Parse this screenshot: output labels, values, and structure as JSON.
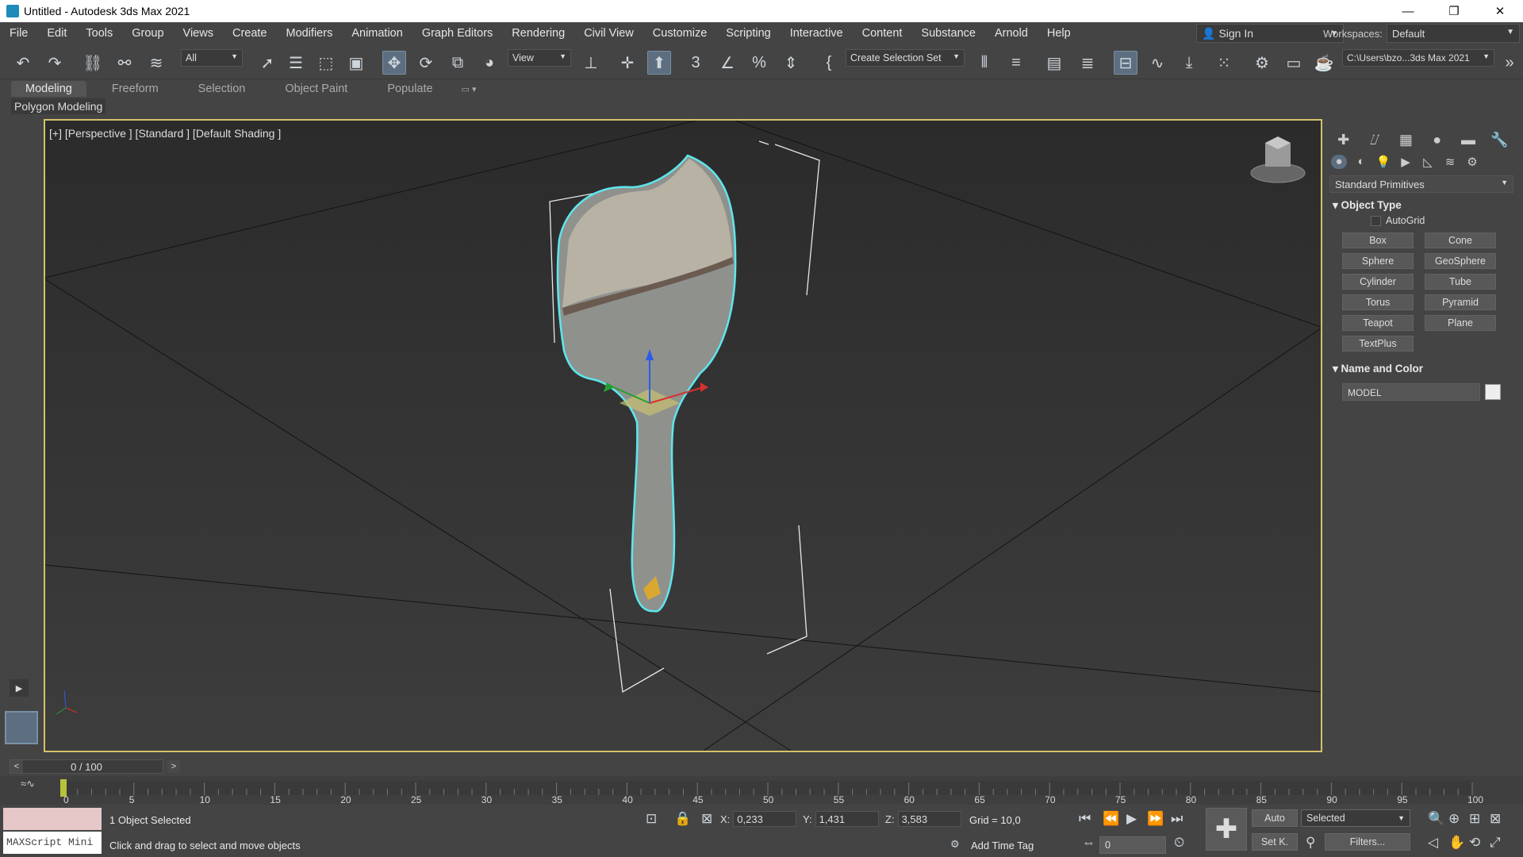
{
  "window": {
    "title": "Untitled - Autodesk 3ds Max 2021",
    "minimize": "—",
    "maximize": "❐",
    "close": "✕"
  },
  "menu": [
    "File",
    "Edit",
    "Tools",
    "Group",
    "Views",
    "Create",
    "Modifiers",
    "Animation",
    "Graph Editors",
    "Rendering",
    "Civil View",
    "Customize",
    "Scripting",
    "Interactive",
    "Content",
    "Substance",
    "Arnold",
    "Help"
  ],
  "signin": {
    "label": "Sign In"
  },
  "workspaces": {
    "label": "Workspaces:",
    "value": "Default"
  },
  "toolbar": {
    "filter": "All",
    "refcoord": "View",
    "selection_set": "Create Selection Set",
    "project_path": "C:\\Users\\bzo...3ds Max 2021"
  },
  "ribbon": {
    "tabs": [
      "Modeling",
      "Freeform",
      "Selection",
      "Object Paint",
      "Populate"
    ],
    "active": "Modeling",
    "panel": "Polygon Modeling"
  },
  "viewport": {
    "label": "[+] [Perspective ] [Standard ] [Default Shading ]"
  },
  "command_panel": {
    "category": "Standard Primitives",
    "object_type": {
      "header": "Object Type",
      "autogrid": "AutoGrid",
      "buttons": [
        "Box",
        "Cone",
        "Sphere",
        "GeoSphere",
        "Cylinder",
        "Tube",
        "Torus",
        "Pyramid",
        "Teapot",
        "Plane",
        "TextPlus"
      ]
    },
    "name_color": {
      "header": "Name and Color",
      "name": "MODEL",
      "color": "#eeeeee"
    }
  },
  "timeline": {
    "frame": "0 / 100",
    "ticks": [
      "0",
      "5",
      "10",
      "15",
      "20",
      "25",
      "30",
      "35",
      "40",
      "45",
      "50",
      "55",
      "60",
      "65",
      "70",
      "75",
      "80",
      "85",
      "90",
      "95",
      "100"
    ]
  },
  "status": {
    "selected": "1 Object Selected",
    "prompt": "Click and drag to select and move objects",
    "maxscript": "MAXScript Mini",
    "x_label": "X:",
    "x": "0,233",
    "y_label": "Y:",
    "y": "1,431",
    "z_label": "Z:",
    "z": "3,583",
    "grid": "Grid = 10,0",
    "add_time_tag": "Add Time Tag",
    "auto": "Auto",
    "set_key": "Set K.",
    "selected_dd": "Selected",
    "filters": "Filters...",
    "frame_field": "0"
  }
}
